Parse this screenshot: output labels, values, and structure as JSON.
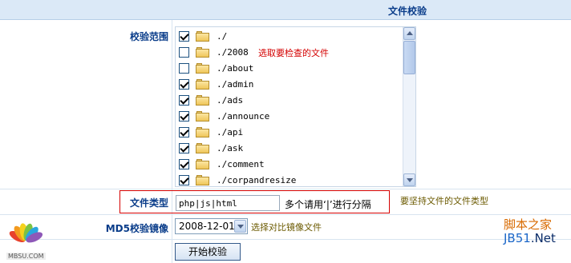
{
  "header": {
    "title": "文件校验"
  },
  "scope": {
    "label": "校验范围",
    "hint": "选取要检查的文件",
    "items": [
      {
        "name": "./",
        "checked": true
      },
      {
        "name": "./2008",
        "checked": false
      },
      {
        "name": "./about",
        "checked": false
      },
      {
        "name": "./admin",
        "checked": true
      },
      {
        "name": "./ads",
        "checked": true
      },
      {
        "name": "./announce",
        "checked": true
      },
      {
        "name": "./api",
        "checked": true
      },
      {
        "name": "./ask",
        "checked": true
      },
      {
        "name": "./comment",
        "checked": true
      },
      {
        "name": "./corpandresize",
        "checked": true
      }
    ]
  },
  "filetype": {
    "label": "文件类型",
    "value": "php|js|html",
    "separator_hint": "多个请用‘|’进行分隔",
    "note": "要坚持文件的文件类型"
  },
  "md5": {
    "label": "MD5校验镜像",
    "selected": "2008-12-01",
    "note": "选择对比镜像文件"
  },
  "submit": {
    "label": "开始校验"
  },
  "watermark": {
    "left_text": "MBSU.COM",
    "right_line1": "脚本之家",
    "right_line2_a": "JB51",
    "right_line2_b": ".Net"
  },
  "colors": {
    "label_blue": "#0a3d8a",
    "header_bg": "#dbe9f7",
    "highlight_red": "#d40000"
  }
}
